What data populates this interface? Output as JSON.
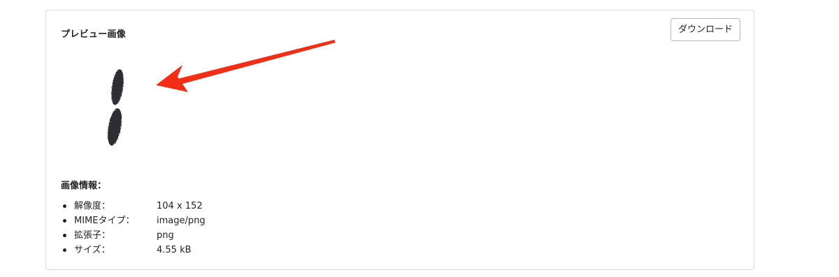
{
  "preview": {
    "title": "プレビュー画像",
    "download_label": "ダウンロード",
    "arrow_color": "#f22f16",
    "image_stroke_color": "#2d2f33"
  },
  "info": {
    "heading": "画像情報：",
    "items": [
      {
        "label": "解像度：",
        "value": "104 x 152"
      },
      {
        "label": "MIMEタイプ：",
        "value": "image/png"
      },
      {
        "label": "拡張子：",
        "value": "png"
      },
      {
        "label": "サイズ：",
        "value": "4.55 kB"
      }
    ]
  }
}
